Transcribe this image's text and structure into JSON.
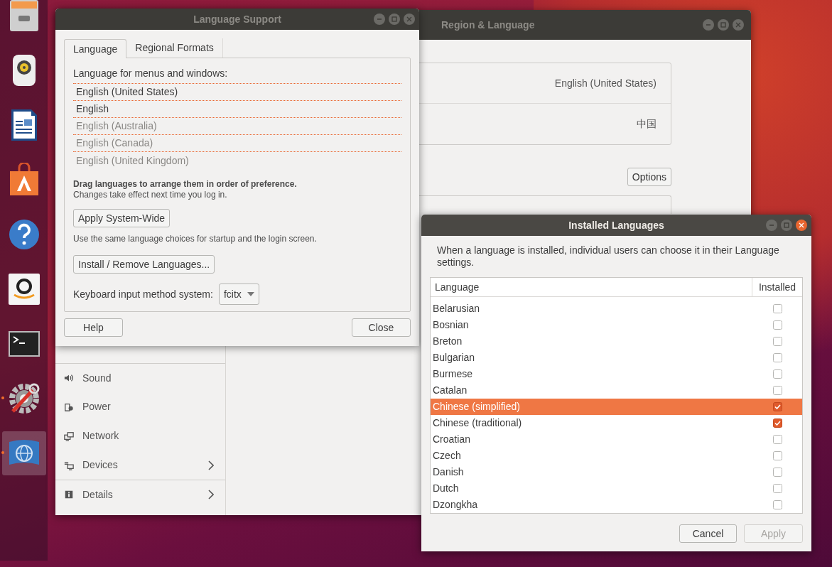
{
  "dock": {
    "items": [
      {
        "kind": "files",
        "running": false,
        "selected": false
      },
      {
        "kind": "speaker",
        "running": false,
        "selected": false
      },
      {
        "kind": "document",
        "running": false,
        "selected": false
      },
      {
        "kind": "store",
        "running": false,
        "selected": false
      },
      {
        "kind": "help",
        "running": false,
        "selected": false
      },
      {
        "kind": "shop",
        "running": false,
        "selected": false
      },
      {
        "kind": "terminal",
        "running": false,
        "selected": false
      },
      {
        "kind": "tools",
        "running": true,
        "selected": false
      },
      {
        "kind": "globe",
        "running": true,
        "selected": true
      }
    ]
  },
  "region_window": {
    "title": "Region & Language",
    "focused": false,
    "sidebar": [
      {
        "kind": "sound",
        "label": "Sound",
        "arrow": false
      },
      {
        "kind": "power",
        "label": "Power",
        "arrow": false
      },
      {
        "kind": "network",
        "label": "Network",
        "arrow": false
      },
      {
        "kind": "devices",
        "label": "Devices",
        "arrow": true
      },
      {
        "kind": "info",
        "label": "Details",
        "arrow": true
      }
    ],
    "rows": [
      {
        "value": "English (United States)"
      },
      {
        "value": "中国"
      }
    ],
    "options_button": "Options"
  },
  "language_support": {
    "title": "Language Support",
    "focused": false,
    "tabs": [
      {
        "label": "Language",
        "selected": true
      },
      {
        "label": "Regional Formats",
        "selected": false
      }
    ],
    "heading": "Language for menus and windows:",
    "languages": [
      {
        "label": "English (United States)",
        "active": true
      },
      {
        "label": "English",
        "active": true
      },
      {
        "label": "English (Australia)",
        "active": false
      },
      {
        "label": "English (Canada)",
        "active": false
      },
      {
        "label": "English (United Kingdom)",
        "active": false
      }
    ],
    "drag_note": "Drag languages to arrange them in order of preference.",
    "changes_note": "Changes take effect next time you log in.",
    "apply_button": "Apply System-Wide",
    "apply_note": "Use the same language choices for startup and the login screen.",
    "install_button": "Install / Remove Languages...",
    "input_method_label": "Keyboard input method system:",
    "input_method_value": "fcitx",
    "help_button": "Help",
    "close_button": "Close"
  },
  "installed_languages": {
    "title": "Installed Languages",
    "focused": true,
    "description": "When a language is installed, individual users can choose it in their Language settings.",
    "columns": [
      "Language",
      "Installed"
    ],
    "rows": [
      {
        "label": "Belarusian",
        "installed": false,
        "selected": false
      },
      {
        "label": "Bosnian",
        "installed": false,
        "selected": false
      },
      {
        "label": "Breton",
        "installed": false,
        "selected": false
      },
      {
        "label": "Bulgarian",
        "installed": false,
        "selected": false
      },
      {
        "label": "Burmese",
        "installed": false,
        "selected": false
      },
      {
        "label": "Catalan",
        "installed": false,
        "selected": false
      },
      {
        "label": "Chinese (simplified)",
        "installed": true,
        "selected": true
      },
      {
        "label": "Chinese (traditional)",
        "installed": true,
        "selected": false
      },
      {
        "label": "Croatian",
        "installed": false,
        "selected": false
      },
      {
        "label": "Czech",
        "installed": false,
        "selected": false
      },
      {
        "label": "Danish",
        "installed": false,
        "selected": false
      },
      {
        "label": "Dutch",
        "installed": false,
        "selected": false
      },
      {
        "label": "Dzongkha",
        "installed": false,
        "selected": false
      }
    ],
    "cancel_button": {
      "label": "Cancel",
      "disabled": false
    },
    "apply_button": {
      "label": "Apply",
      "disabled": true
    }
  }
}
